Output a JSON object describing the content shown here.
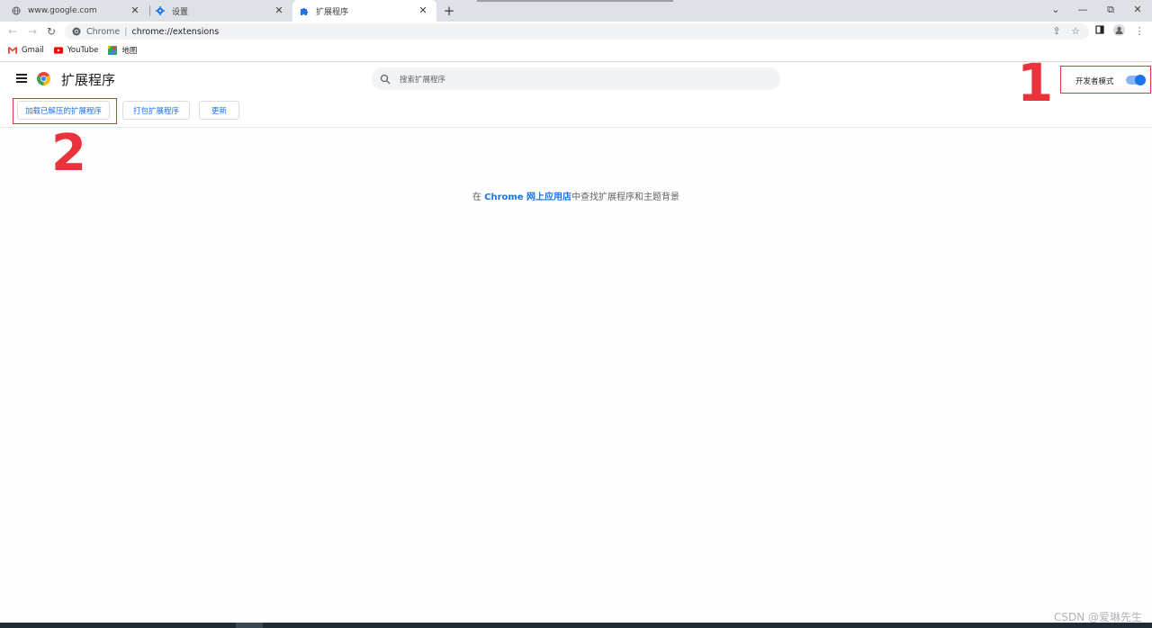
{
  "tabs": [
    {
      "title": "www.google.com",
      "icon": "globe-icon"
    },
    {
      "title": "设置",
      "icon": "gear-icon"
    },
    {
      "title": "扩展程序",
      "icon": "puzzle-icon",
      "active": true
    }
  ],
  "window_controls": {
    "minimize": "—",
    "restore": "⧉",
    "close": "✕",
    "chevron": "⌄"
  },
  "omnibox": {
    "host": "Chrome",
    "path": "chrome://extensions"
  },
  "bookmarks": [
    {
      "label": "Gmail",
      "icon": "gmail-icon"
    },
    {
      "label": "YouTube",
      "icon": "youtube-icon"
    },
    {
      "label": "地图",
      "icon": "maps-icon"
    }
  ],
  "header": {
    "title": "扩展程序",
    "search_placeholder": "搜索扩展程序",
    "dev_mode_label": "开发者模式",
    "dev_mode_on": true
  },
  "buttons": {
    "load_unpacked": "加载已解压的扩展程序",
    "pack": "打包扩展程序",
    "update": "更新"
  },
  "annotations": {
    "marker1": "1",
    "marker2": "2"
  },
  "promo": {
    "prefix": "在",
    "store_link": "Chrome 网上应用店",
    "suffix": "中查找扩展程序和主题背景"
  },
  "watermark": "CSDN @爱琳先生",
  "colors": {
    "accent": "#1a73e8",
    "annotation": "#e8323c"
  }
}
